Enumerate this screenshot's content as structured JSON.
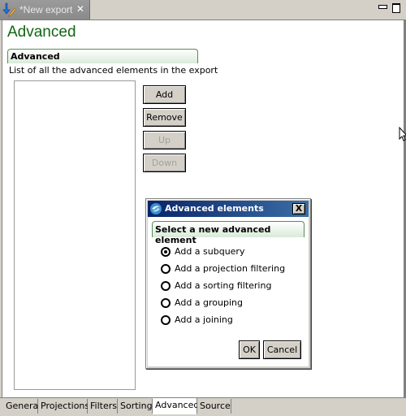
{
  "editor": {
    "tab_title": "*New export",
    "tab_icon": "pencil-arrow-icon",
    "close_symbol": "✕"
  },
  "page": {
    "title": "Advanced",
    "section": {
      "title": "Advanced",
      "description": "List of all the advanced elements in the export"
    },
    "list_items": [],
    "buttons": {
      "add": "Add",
      "remove": "Remove",
      "up": "Up",
      "down": "Down"
    }
  },
  "bottom_tabs": [
    {
      "label": "General",
      "active": false
    },
    {
      "label": "Projections",
      "active": false
    },
    {
      "label": "Filters",
      "active": false
    },
    {
      "label": "Sorting",
      "active": false
    },
    {
      "label": "Advanced",
      "active": true
    },
    {
      "label": "Source",
      "active": false
    }
  ],
  "dialog": {
    "title": "Advanced elements",
    "close_symbol": "X",
    "section_title": "Select a new advanced element",
    "options": [
      {
        "label": "Add a subquery",
        "selected": true
      },
      {
        "label": "Add a projection filtering",
        "selected": false
      },
      {
        "label": "Add a sorting filtering",
        "selected": false
      },
      {
        "label": "Add a grouping",
        "selected": false
      },
      {
        "label": "Add a joining",
        "selected": false
      }
    ],
    "ok_label": "OK",
    "cancel_label": "Cancel"
  }
}
